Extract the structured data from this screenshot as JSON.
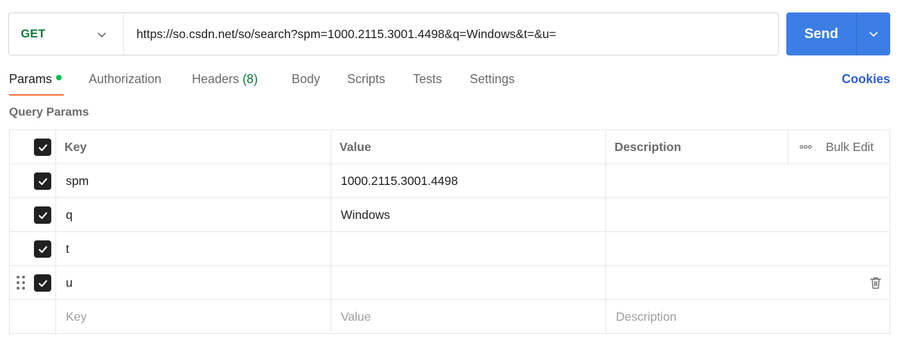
{
  "request": {
    "method": "GET",
    "url": "https://so.csdn.net/so/search?spm=1000.2115.3001.4498&q=Windows&t=&u=",
    "send_label": "Send"
  },
  "tabs": [
    {
      "label": "Params",
      "active": true
    },
    {
      "label": "Authorization"
    },
    {
      "label": "Headers",
      "count": "(8)"
    },
    {
      "label": "Body"
    },
    {
      "label": "Scripts"
    },
    {
      "label": "Tests"
    },
    {
      "label": "Settings"
    }
  ],
  "cookies_label": "Cookies",
  "query_params": {
    "title": "Query Params",
    "headers": {
      "key": "Key",
      "value": "Value",
      "description": "Description"
    },
    "bulk_edit_label": "Bulk Edit",
    "rows": [
      {
        "key": "spm",
        "value": "1000.2115.3001.4498",
        "description": "",
        "checked": true
      },
      {
        "key": "q",
        "value": "Windows",
        "description": "",
        "checked": true
      },
      {
        "key": "t",
        "value": "",
        "description": "",
        "checked": true
      },
      {
        "key": "u",
        "value": "",
        "description": "",
        "checked": true
      }
    ],
    "placeholders": {
      "key": "Key",
      "value": "Value",
      "description": "Description"
    }
  },
  "colors": {
    "method": "#0d7a3a",
    "send": "#3d7ee6",
    "active_tab_underline": "#ff6c37",
    "params_dot": "#0cbb52",
    "cookies": "#2f5fce"
  },
  "icons": [
    "chevron-down-icon",
    "checkbox-checked-icon",
    "drag-handle-icon",
    "trash-icon",
    "more-horizontal-icon"
  ]
}
